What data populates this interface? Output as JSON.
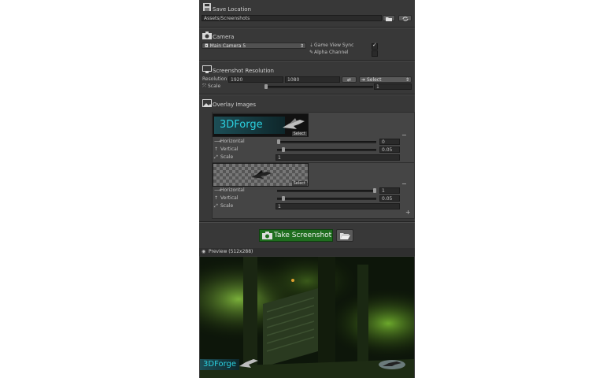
{
  "save_location": {
    "title": "Save Location",
    "path": "Assets/Screenshots",
    "folder_icon": "folder-icon",
    "refresh_icon": "refresh-icon"
  },
  "camera": {
    "title": "Camera",
    "selected": "Main Camera 5",
    "game_view_sync_label": "Game View Sync",
    "game_view_sync_checked": true,
    "alpha_channel_label": "Alpha Channel",
    "alpha_channel_checked": false
  },
  "resolution": {
    "title": "Screenshot Resolution",
    "resolution_label": "Resolution",
    "width": "1920",
    "height": "1080",
    "select_label": "Select",
    "scale_label": "Scale",
    "scale_value": "1"
  },
  "overlays": {
    "title": "Overlay Images",
    "items": [
      {
        "logo_text": "3DForge",
        "select_label": "Select",
        "horizontal_label": "Horizontal",
        "horizontal_value": "0",
        "horizontal_fraction": 0.0,
        "vertical_label": "Vertical",
        "vertical_value": "0.05",
        "vertical_fraction": 0.05,
        "scale_label": "Scale",
        "scale_value": "1"
      },
      {
        "logo_text": "",
        "select_label": "Select",
        "horizontal_label": "Horizontal",
        "horizontal_value": "1",
        "horizontal_fraction": 1.0,
        "vertical_label": "Vertical",
        "vertical_value": "0.05",
        "vertical_fraction": 0.05,
        "scale_label": "Scale",
        "scale_value": "1"
      }
    ],
    "remove_label": "−",
    "add_label": "+"
  },
  "actions": {
    "take_screenshot_label": "Take Screenshot",
    "open_folder_icon": "open-folder-icon"
  },
  "preview": {
    "title": "Preview (512x288)",
    "logo_text": "3DForge"
  },
  "colors": {
    "panel_bg": "#383838",
    "accent_green": "#1f6e1f",
    "logo_cyan": "#2bd0e0"
  }
}
